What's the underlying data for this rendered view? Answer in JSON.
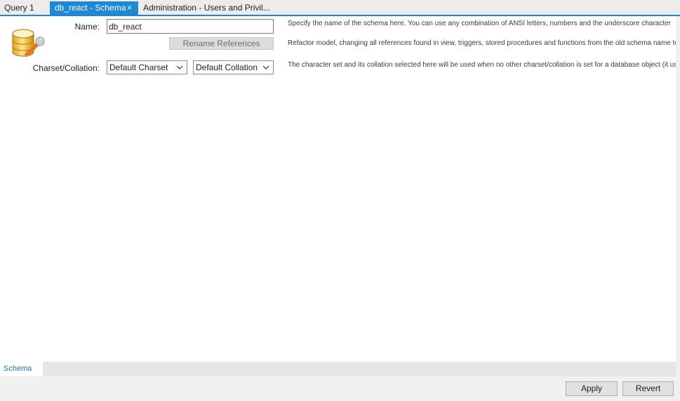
{
  "tabs": {
    "query": "Query 1",
    "schema": "db_react - Schema",
    "close_glyph": "×",
    "admin": "Administration - Users and Privil..."
  },
  "form": {
    "name_label": "Name:",
    "name_value": "db_react",
    "rename_button": "Rename References",
    "charset_label": "Charset/Collation:",
    "charset_value": "Default Charset",
    "collation_value": "Default Collation"
  },
  "descriptions": {
    "name": "Specify the name of the schema here. You can use any combination of ANSI letters, numbers and the underscore character",
    "rename": "Refactor model, changing all references found in view, triggers, stored procedures and functions from the old schema name to the new",
    "charset": "The character set and its collation selected here will be used when no other charset/collation is set for a database object (it us"
  },
  "bottom_tabs": {
    "schema": "Schema"
  },
  "footer": {
    "apply": "Apply",
    "revert": "Revert"
  },
  "colors": {
    "accent": "#1e88d4",
    "link": "#1e72c0"
  },
  "icons": {
    "schema": "database-wrench-icon",
    "dropdown": "chevron-down-icon"
  }
}
